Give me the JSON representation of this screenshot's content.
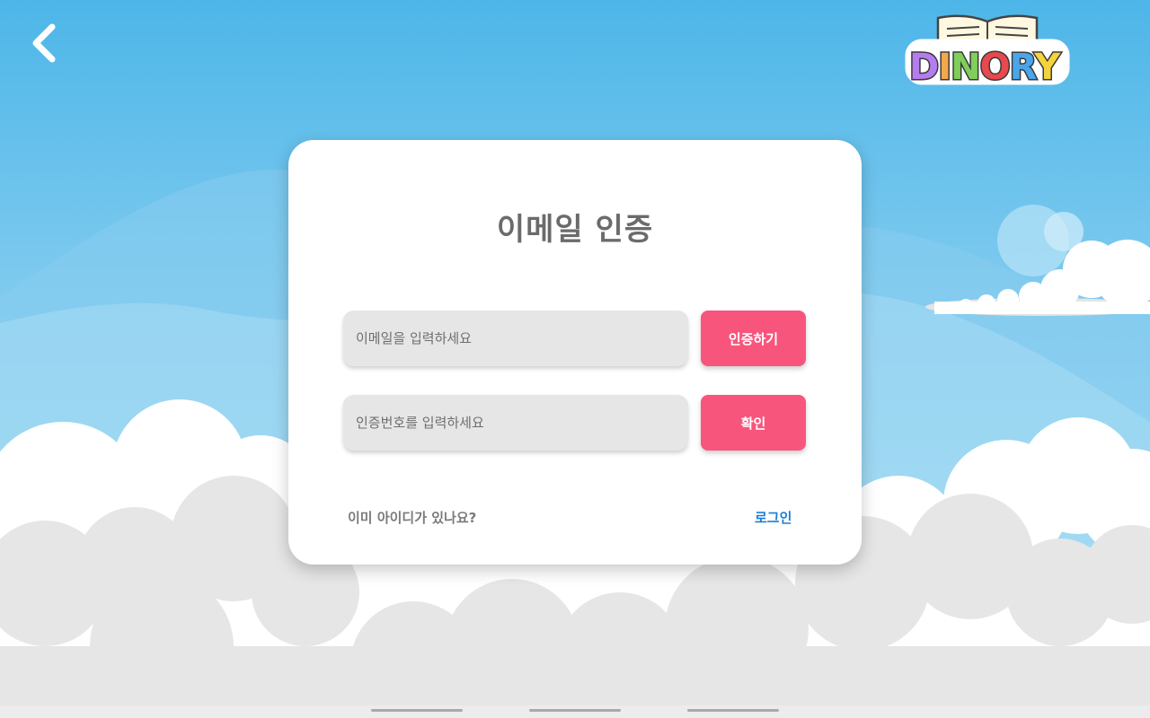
{
  "app": {
    "logo_text": "DINORY"
  },
  "card": {
    "title": "이메일 인증",
    "email_placeholder": "이메일을 입력하세요",
    "verify_button": "인증하기",
    "code_placeholder": "인증번호를 입력하세요",
    "confirm_button": "확인",
    "existing_account_question": "이미 아이디가 있나요?",
    "login_link": "로그인"
  },
  "colors": {
    "accent_pink": "#f8557d",
    "link_blue": "#1e7fd6",
    "sky_top": "#4fb7e9",
    "sky_bottom": "#c9ebfa"
  },
  "icons": [
    "back-chevron-icon",
    "dinory-logo"
  ]
}
